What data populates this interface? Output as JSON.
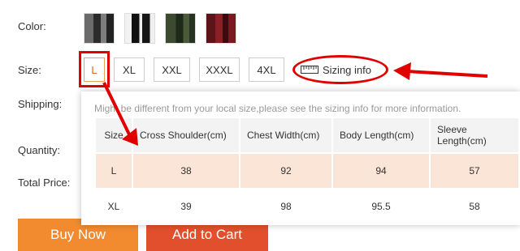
{
  "labels": {
    "color": "Color:",
    "size": "Size:",
    "shipping": "Shipping:",
    "quantity": "Quantity:",
    "total_price": "Total Price:"
  },
  "sizes": [
    "L",
    "XL",
    "XXL",
    "XXXL",
    "4XL"
  ],
  "selected_size": "L",
  "sizing_info": {
    "label": "Sizing info",
    "icon": "ruler-icon"
  },
  "popup": {
    "note": "Might be different from your local size,please see the sizing info for more information.",
    "headers": [
      "Size",
      "Cross Shoulder(cm)",
      "Chest Width(cm)",
      "Body Length(cm)",
      "Sleeve Length(cm)"
    ],
    "rows": [
      [
        "L",
        "38",
        "92",
        "94",
        "57"
      ],
      [
        "XL",
        "39",
        "98",
        "95.5",
        "58"
      ]
    ]
  },
  "buttons": {
    "buy_now": "Buy Now",
    "add_to_cart": "Add to Cart"
  },
  "colors": {
    "annotation": "#e00000",
    "selected_row": "#fbe5d6",
    "buy_now": "#f28b30",
    "add_to_cart": "#e24f2c"
  }
}
